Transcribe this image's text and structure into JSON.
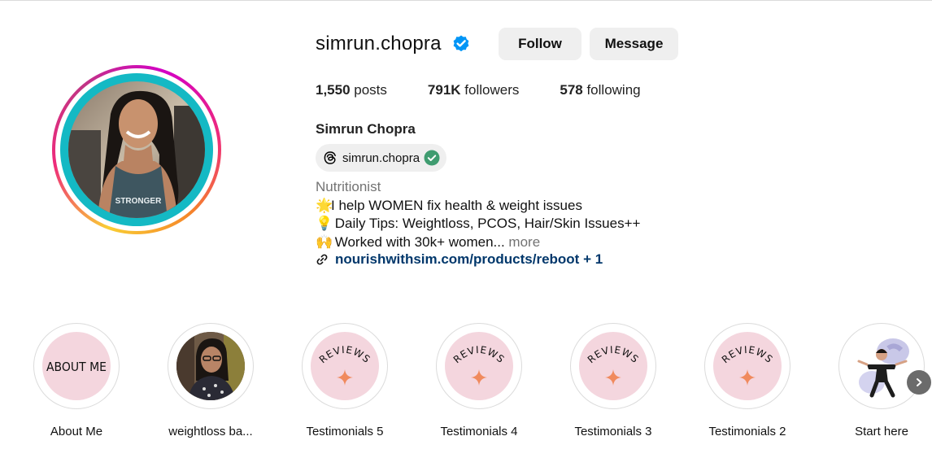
{
  "profile": {
    "username": "simrun.chopra",
    "full_name": "Simrun Chopra",
    "verified_icon": "verified-badge-icon",
    "avatar_shirt_text": "STRONGER"
  },
  "actions": {
    "follow_label": "Follow",
    "message_label": "Message"
  },
  "stats": {
    "posts_count": "1,550",
    "posts_label": " posts",
    "followers_count": "791K",
    "followers_label": " followers",
    "following_count": "578",
    "following_label": " following"
  },
  "threads": {
    "handle": "simrun.chopra",
    "icon": "threads-icon"
  },
  "bio": {
    "category": "Nutritionist",
    "line1_emoji": "🌟",
    "line1": "I help WOMEN fix health & weight issues",
    "line2_emoji": "💡",
    "line2": " Daily Tips: Weightloss, PCOS, Hair/Skin Issues++",
    "line3_emoji": "🙌",
    "line3": "  Worked with 30k+ women...",
    "more_label": " more"
  },
  "link": {
    "text": "nourishwithsim.com/products/reboot + 1",
    "icon": "link-icon"
  },
  "highlights": [
    {
      "label": "About Me",
      "cover_text": "ABOUT ME"
    },
    {
      "label": "weightloss ba...",
      "cover_text": ""
    },
    {
      "label": "Testimonials 5",
      "cover_text": "REVIEWS"
    },
    {
      "label": "Testimonials 4",
      "cover_text": "REVIEWS"
    },
    {
      "label": "Testimonials 3",
      "cover_text": "REVIEWS"
    },
    {
      "label": "Testimonials 2",
      "cover_text": "REVIEWS"
    },
    {
      "label": "Start here",
      "cover_text": ""
    }
  ],
  "colors": {
    "button_bg": "#efefef",
    "link": "#00376b",
    "verified": "#0095f6",
    "avatar_ring_inner": "#14b9c4",
    "highlight_pink": "#f4d6de",
    "sparkle": "#f08a5d"
  }
}
